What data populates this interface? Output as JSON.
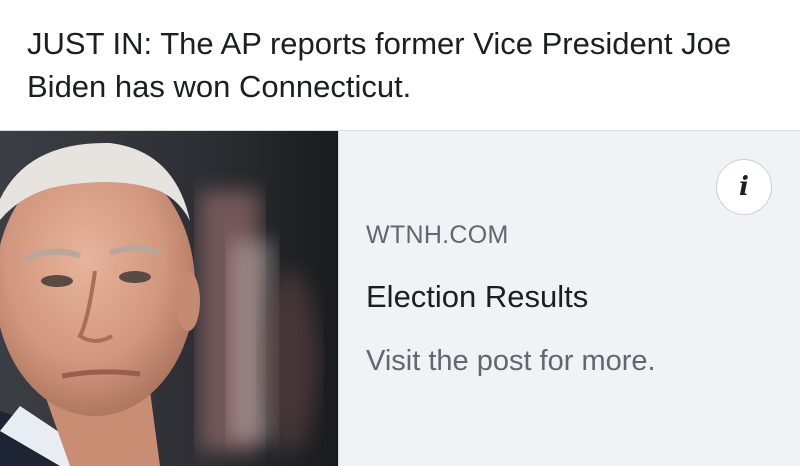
{
  "post": {
    "text": "JUST IN: The AP reports former Vice President Joe Biden has won Connecticut."
  },
  "link_card": {
    "image_alt": "Photo of Joe Biden",
    "domain": "WTNH.COM",
    "headline": "Election Results",
    "description": "Visit the post for more.",
    "info_icon": "info-icon",
    "info_glyph": "i"
  },
  "colors": {
    "card_background": "#f0f2f5",
    "primary_text": "#1c1e21",
    "secondary_text": "#606770"
  }
}
